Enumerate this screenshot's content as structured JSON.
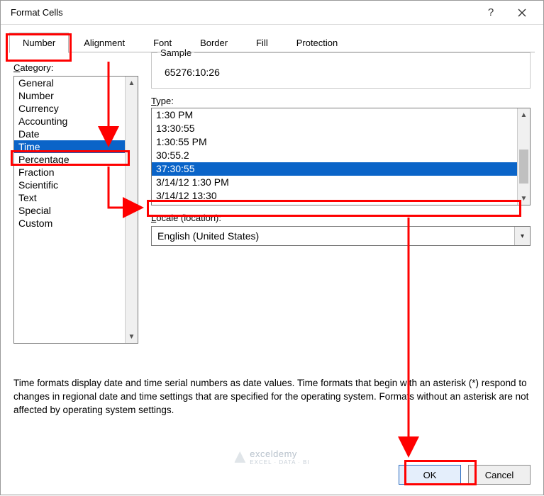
{
  "dialog": {
    "title": "Format Cells"
  },
  "tabs": {
    "number": "Number",
    "alignment": "Alignment",
    "font": "Font",
    "border": "Border",
    "fill": "Fill",
    "protection": "Protection"
  },
  "category": {
    "label": "Category:",
    "items": [
      "General",
      "Number",
      "Currency",
      "Accounting",
      "Date",
      "Time",
      "Percentage",
      "Fraction",
      "Scientific",
      "Text",
      "Special",
      "Custom"
    ],
    "selected_index": 5
  },
  "sample": {
    "label": "Sample",
    "value": "65276:10:26"
  },
  "type": {
    "label": "Type:",
    "items": [
      "1:30 PM",
      "13:30:55",
      "1:30:55 PM",
      "30:55.2",
      "37:30:55",
      "3/14/12 1:30 PM",
      "3/14/12 13:30"
    ],
    "selected_index": 4
  },
  "locale": {
    "label": "Locale (location):",
    "value": "English (United States)"
  },
  "description": "Time formats display date and time serial numbers as date values.  Time formats that begin with an asterisk (*) respond to changes in regional date and time settings that are specified for the operating system. Formats without an asterisk are not affected by operating system settings.",
  "buttons": {
    "ok": "OK",
    "cancel": "Cancel"
  },
  "watermark": {
    "name": "exceldemy",
    "sub": "EXCEL · DATA · BI"
  }
}
